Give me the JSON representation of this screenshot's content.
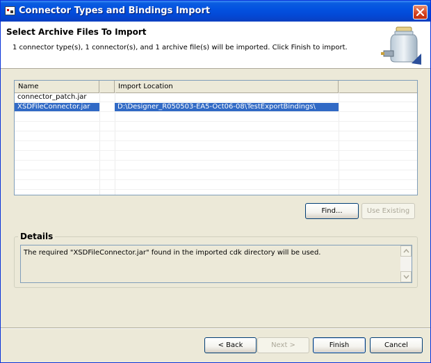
{
  "window": {
    "title": "Connector Types and Bindings Import"
  },
  "header": {
    "title": "Select Archive Files To Import",
    "description": "1 connector type(s), 1 connector(s), and 1 archive file(s) will be imported. Click Finish to import.",
    "icon": "jar-icon"
  },
  "table": {
    "columns": [
      "Name",
      "",
      "Import Location",
      ""
    ],
    "rows": [
      {
        "name": "connector_patch.jar",
        "flag": "",
        "location": ""
      },
      {
        "name": "XSDFileConnector.jar",
        "flag": "",
        "location": "D:\\Designer_R050503-EA5-Oct06-08\\TestExportBindings\\",
        "selected": true
      }
    ]
  },
  "buttons": {
    "find": "Find...",
    "use_existing": "Use Existing",
    "back": "< Back",
    "next": "Next >",
    "finish": "Finish",
    "cancel": "Cancel"
  },
  "details": {
    "label": "Details",
    "text": "The required \"XSDFileConnector.jar\" found in the imported cdk directory will be used."
  },
  "colors": {
    "titlebar": "#0a5ce0",
    "selection": "#316ac5",
    "dialog_bg": "#ece9d8"
  }
}
